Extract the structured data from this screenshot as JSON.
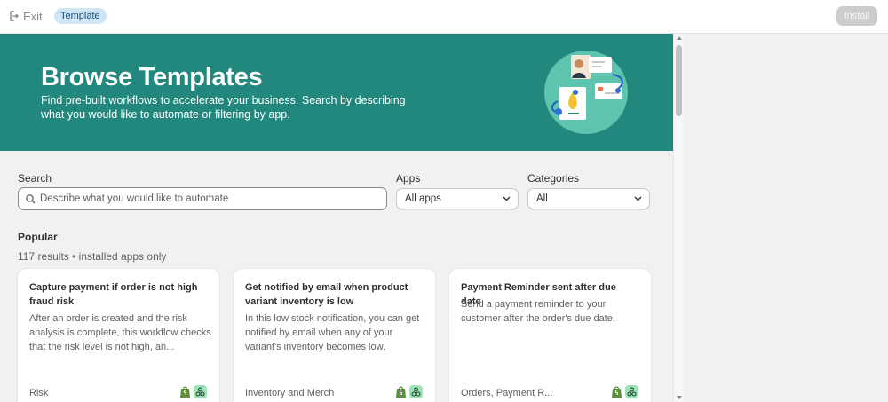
{
  "topbar": {
    "exit_label": "Exit",
    "tag_label": "Template",
    "install_label": "Install"
  },
  "hero": {
    "title": "Browse Templates",
    "description": "Find pre-built workflows to accelerate your business. Search by describing what you would like to automate or filtering by app.",
    "background_color": "#22877c"
  },
  "filters": {
    "search_label": "Search",
    "search_placeholder": "Describe what you would like to automate",
    "apps_label": "Apps",
    "apps_value": "All apps",
    "categories_label": "Categories",
    "categories_value": "All"
  },
  "section": {
    "title": "Popular",
    "results": "117 results • installed apps only"
  },
  "cards": [
    {
      "title": "Capture payment if order is not high fraud risk",
      "description": "After an order is created and the risk analysis is complete, this workflow checks that the risk level is not high, an...",
      "category": "Risk",
      "icons": [
        "shopify-icon",
        "flow-icon"
      ]
    },
    {
      "title": "Get notified by email when product variant inventory is low",
      "description": "In this low stock notification, you can get notified by email when any of your variant's inventory becomes low.",
      "category": "Inventory and Merch",
      "icons": [
        "shopify-icon",
        "flow-icon"
      ]
    },
    {
      "title": "Payment Reminder sent after due date",
      "description": "Send a payment reminder to your customer after the order's due date.",
      "category": "Orders, Payment R...",
      "icons": [
        "shopify-icon",
        "flow-icon"
      ]
    }
  ]
}
